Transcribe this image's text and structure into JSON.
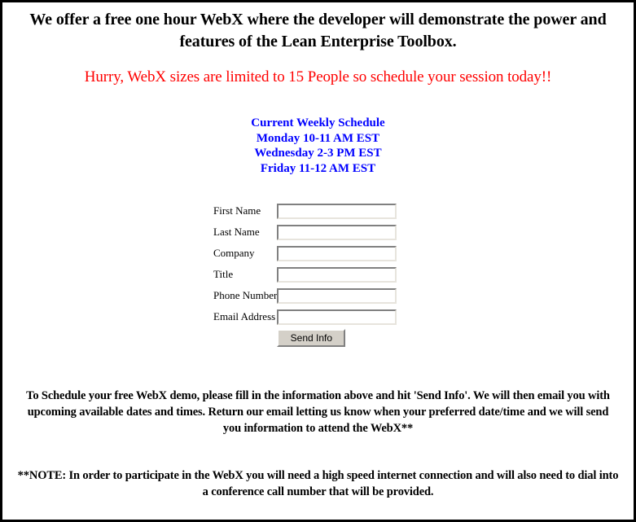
{
  "page": {
    "headline": "We offer a free one hour WebX where the developer will demonstrate the power and features of the Lean Enterprise Toolbox.",
    "subhead": "Hurry, WebX sizes are limited to 15 People so schedule your session today!!",
    "border_color": "#000000",
    "background_color": "#ffffff"
  },
  "schedule": {
    "title": "Current Weekly Schedule",
    "color": "#0000FF",
    "lines": [
      "Monday 10-11 AM EST",
      "Wednesday 2-3 PM EST",
      "Friday 11-12 AM EST"
    ]
  },
  "form": {
    "fields": [
      {
        "label": "First Name",
        "value": "",
        "placeholder": ""
      },
      {
        "label": "Last Name",
        "value": "",
        "placeholder": ""
      },
      {
        "label": "Company",
        "value": "",
        "placeholder": ""
      },
      {
        "label": "Title",
        "value": "",
        "placeholder": ""
      },
      {
        "label": "Phone Number",
        "value": "",
        "placeholder": ""
      },
      {
        "label": "Email Address",
        "value": "",
        "placeholder": ""
      }
    ],
    "submit_label": "Send Info"
  },
  "footer": {
    "instructions": "To Schedule your free WebX demo, please fill in the information above and hit 'Send Info'.  We will then email you with upcoming available dates and times.  Return our email letting us know when your preferred date/time and we will send you information to attend the WebX**",
    "note": "**NOTE:  In order to participate in the WebX you will need a high speed internet connection and will also need to dial into a conference call number that will be provided."
  },
  "colors": {
    "alert_red": "#FF0000",
    "schedule_blue": "#0000FF",
    "text_black": "#000000",
    "button_face": "#d4d0c8"
  }
}
